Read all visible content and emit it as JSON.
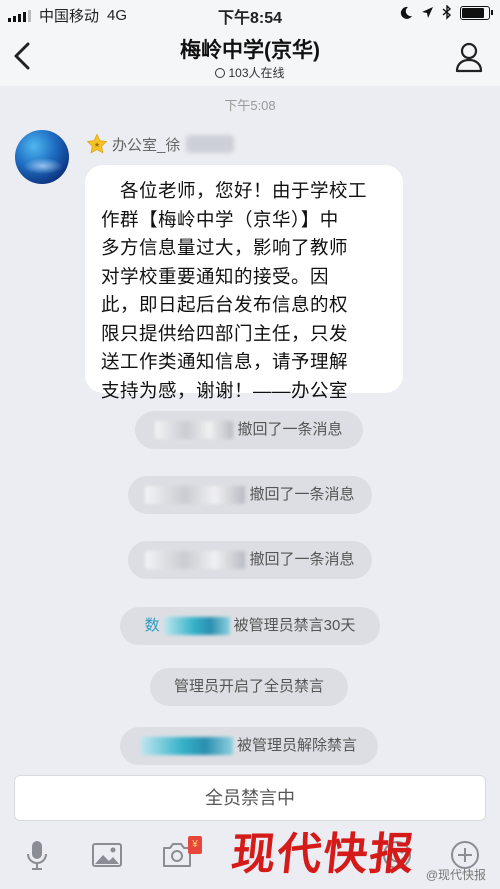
{
  "status_bar": {
    "carrier": "中国移动",
    "network": "4G",
    "time": "下午8:54",
    "battery_level": 0.85
  },
  "header": {
    "title": "梅岭中学(京华)",
    "online_count": "103人在线"
  },
  "chat": {
    "timestamp": "下午5:08",
    "sender_name": "办公室_徐",
    "message": "各位老师，您好！由于学校工作群【梅岭中学（京华）】中多方信息量过大，影响了教师对学校重要通知的接受。因此，即日起后台发布信息的权限只提供给四部门主任，只发送工作类通知信息，请予理解支持为感，谢谢！——办公室",
    "message_lines": [
      "　各位老师，您好！由于学校工",
      "作群【梅岭中学（京华）】中",
      "多方信息量过大，影响了教师",
      "对学校重要通知的接受。因",
      "此，即日起后台发布信息的权",
      "限只提供给四部门主任，只发",
      "送工作类通知信息，请予理解",
      "支持为感，谢谢！——办公室"
    ],
    "notices": [
      {
        "text": "撤回了一条消息"
      },
      {
        "text": "撤回了一条消息"
      },
      {
        "text": "撤回了一条消息"
      },
      {
        "prefix": "数",
        "text": "被管理员禁言30天"
      },
      {
        "text": "管理员开启了全员禁言"
      },
      {
        "text": "被管理员解除禁言"
      }
    ]
  },
  "input": {
    "muted_label": "全员禁言中"
  },
  "toolbar": {
    "icons": [
      "microphone-icon",
      "image-icon",
      "camera-icon",
      "red-packet-icon",
      "emoji-icon",
      "plus-icon"
    ],
    "red_packet_badge": "¥"
  },
  "watermark": {
    "text": "现代快报",
    "source": "@现代快报"
  },
  "colors": {
    "background": "#ebedf2",
    "bubble": "#ffffff",
    "watermark_red": "#d51a1a",
    "notice_bg": "#dcdee3"
  }
}
